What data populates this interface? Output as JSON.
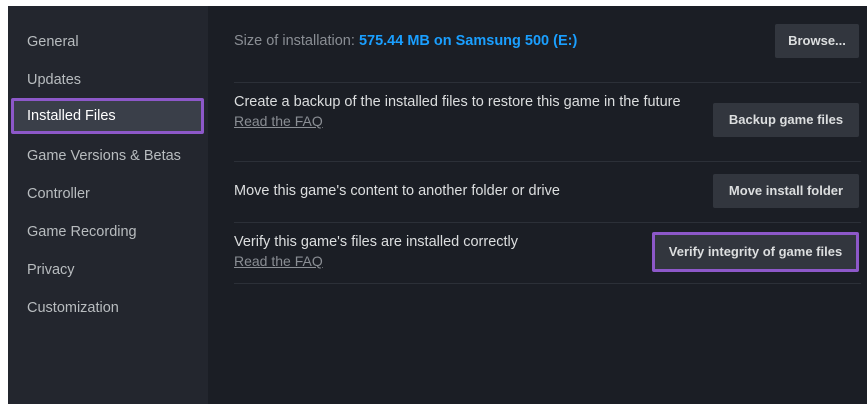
{
  "sidebar": {
    "items": [
      {
        "label": "General"
      },
      {
        "label": "Updates"
      },
      {
        "label": "Installed Files"
      },
      {
        "label": "Game Versions & Betas"
      },
      {
        "label": "Controller"
      },
      {
        "label": "Game Recording"
      },
      {
        "label": "Privacy"
      },
      {
        "label": "Customization"
      }
    ],
    "active_index": 2
  },
  "installed_files": {
    "size_label": "Size of installation:",
    "size_value": "575.44 MB on Samsung 500 (E:)",
    "browse_button": "Browse...",
    "backup": {
      "text": "Create a backup of the installed files to restore this game in the future",
      "link": "Read the FAQ",
      "button": "Backup game files"
    },
    "move": {
      "text": "Move this game's content to another folder or drive",
      "button": "Move install folder"
    },
    "verify": {
      "text": "Verify this game's files are installed correctly",
      "link": "Read the FAQ",
      "button": "Verify integrity of game files"
    }
  },
  "colors": {
    "highlight_border": "#8d58c9",
    "size_value": "#1a9fff",
    "background": "#1b1e25",
    "sidebar_background": "#23262e"
  }
}
